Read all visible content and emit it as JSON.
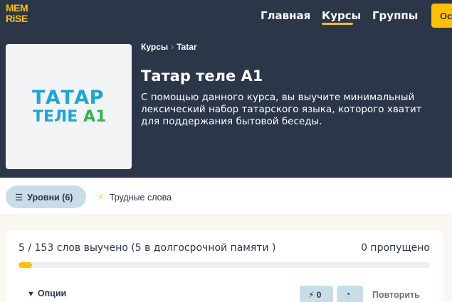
{
  "header": {
    "logo_line1": "MEM",
    "logo_line2": "RiSE",
    "nav": {
      "home": "Главная",
      "courses": "Курсы",
      "groups": "Группы"
    },
    "cta_label": "Ос"
  },
  "course": {
    "image_line1": "ТАТАР",
    "image_line2_word": "ТЕЛЕ",
    "image_line2_level": "А1",
    "breadcrumb": [
      "Курсы",
      "Tatar"
    ],
    "title": "Татар теле А1",
    "description": "С помощью данного курса, вы выучите минимальный лексический набор татарского языка, которого хватит для поддержания бытовой беседы."
  },
  "tabs": {
    "levels_label": "Уровни (6)",
    "difficult_label": "Трудные слова"
  },
  "progress": {
    "learned_text": "5 / 153 слов выучено (5 в долгосрочной памяти )",
    "skipped_text": "0 пропущено",
    "fraction": 0.0327
  },
  "actions": {
    "options_label": "Опции",
    "speed_count": "0",
    "repeat_label": "Повторить"
  },
  "colors": {
    "header_bg": "#2b3648",
    "accent": "#ffc000",
    "pill_bg": "#c8dde7",
    "logo_blue": "#1aa7d6",
    "logo_green": "#2db84d"
  },
  "icons": [
    "list-icon",
    "bolt-icon",
    "chevron-down-icon",
    "clock-icon",
    "breadcrumb-chevron-icon"
  ]
}
